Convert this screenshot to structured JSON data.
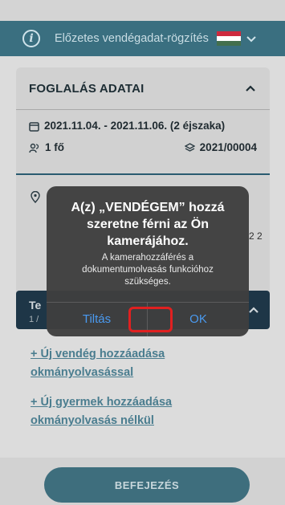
{
  "header": {
    "title": "Előzetes vendégadat-rögzítés",
    "info_icon": "info-icon",
    "flag_colors": [
      "#cd2a3e",
      "#ffffff",
      "#436f4d"
    ]
  },
  "booking": {
    "section_title": "FOGLALÁS ADATAI",
    "dates": "2021.11.04. - 2021.11.06. (2 éjszaka)",
    "guests": "1 fő",
    "booking_number": "2021/00004",
    "partial_value": "2 2"
  },
  "team": {
    "title_fragment": "Te",
    "subtitle_fragment": "1 / "
  },
  "links": {
    "add_guest_scanner": "+ Új vendég hozzáadása okmányolvasással",
    "add_child_no_scanner": "+ Új gyermek hozzáadása okmányolvasás nélkül"
  },
  "footer": {
    "finish_label": "BEFEJEZÉS"
  },
  "dialog": {
    "title": "A(z) „VENDÉGEM” hozzá szeretne férni az Ön kamerájához.",
    "message": "A kamerahozzáférés a dokumentumolvasás funkcióhoz szükséges.",
    "deny_label": "Tiltás",
    "ok_label": "OK"
  },
  "colors": {
    "header_bg": "#3a6f80",
    "accent_link": "#4a7d8f",
    "dialog_button": "#4a9af0",
    "highlight": "#e02020"
  }
}
